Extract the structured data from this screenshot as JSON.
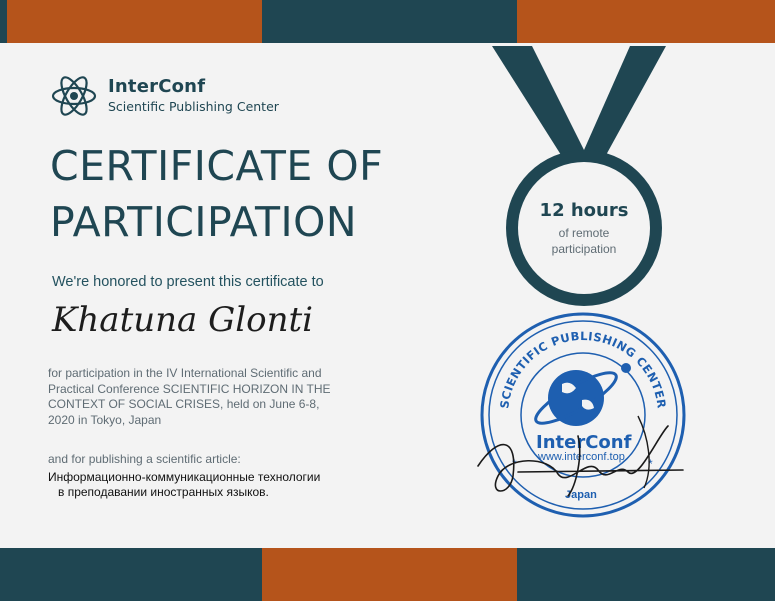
{
  "brand": {
    "name": "InterConf",
    "subtitle": "Scientific Publishing Center"
  },
  "certificate": {
    "title_line1": "CERTIFICATE OF",
    "title_line2": "PARTICIPATION",
    "honored_text": "We're honored to present this certificate to",
    "recipient": "Khatuna Glonti",
    "participation_text": "for participation in the IV International Scientific and Practical Conference SCIENTIFIC HORIZON IN THE CONTEXT OF SOCIAL CRISES, held on June 6-8, 2020 in Tokyo, Japan",
    "article_intro": "and for publishing a scientific article:",
    "article_line1": "Информационно-коммуникационные технологии",
    "article_line2": "в преподавании иностранных языков."
  },
  "medal": {
    "hours": "12 hours",
    "remote_line1": "of remote",
    "remote_line2": "participation"
  },
  "stamp": {
    "ring_text": "SCIENTIFIC PUBLISHING CENTER",
    "brand": "InterConf",
    "site": "www.interconf.top",
    "country": "Japan"
  },
  "colors": {
    "navy": "#1f4652",
    "orange": "#b5541b",
    "background": "#f3f3f3",
    "stamp_blue": "#1e5fb0"
  },
  "icons": {
    "logo": "atom-icon",
    "medal": "medal-icon",
    "stamp": "stamp-globe-icon",
    "signature": "signature-icon"
  }
}
